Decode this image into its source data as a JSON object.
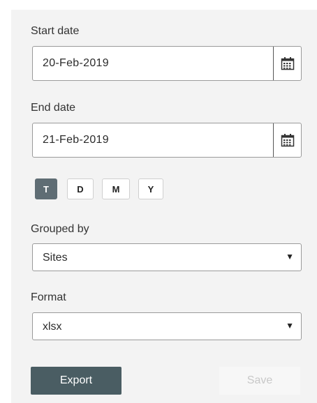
{
  "start_date": {
    "label": "Start date",
    "value": "20-Feb-2019",
    "icon": "calendar-icon"
  },
  "end_date": {
    "label": "End date",
    "value": "21-Feb-2019",
    "icon": "calendar-icon"
  },
  "period_buttons": [
    {
      "label": "T",
      "active": true
    },
    {
      "label": "D",
      "active": false
    },
    {
      "label": "M",
      "active": false
    },
    {
      "label": "Y",
      "active": false
    }
  ],
  "grouped_by": {
    "label": "Grouped by",
    "value": "Sites"
  },
  "format": {
    "label": "Format",
    "value": "xlsx"
  },
  "actions": {
    "export_label": "Export",
    "save_label": "Save",
    "save_enabled": false
  },
  "colors": {
    "accent": "#4a5d63",
    "active_toggle": "#5f6d74",
    "panel_bg": "#f3f3f3"
  }
}
